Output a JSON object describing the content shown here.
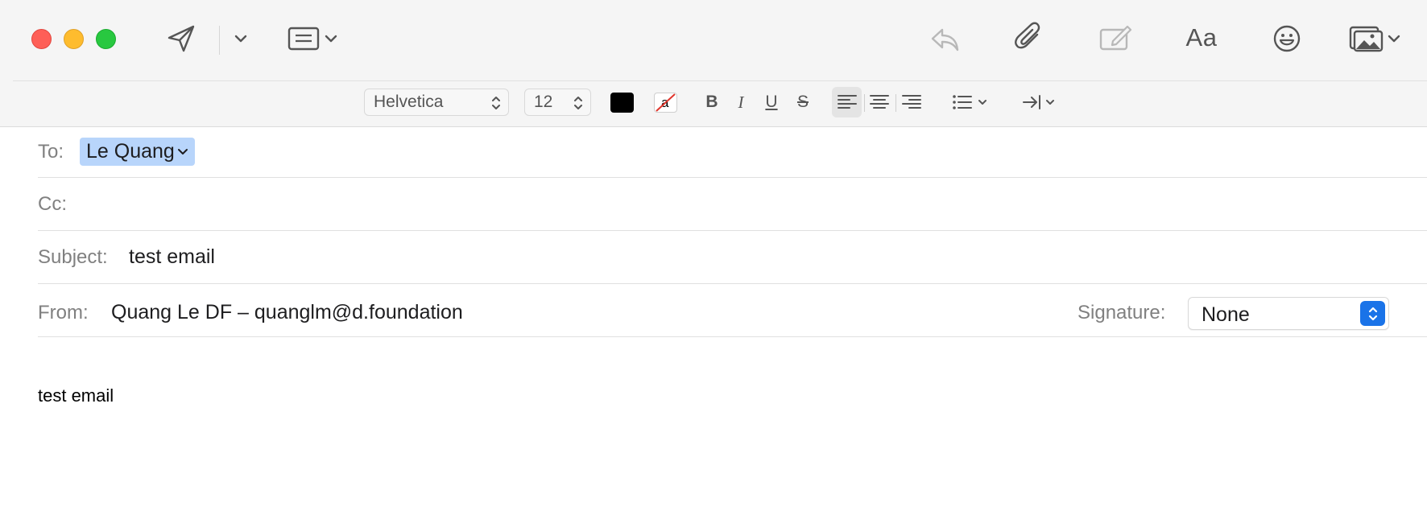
{
  "toolbar": {
    "icons": {
      "send": "paper-plane-icon",
      "send_menu": "chevron-down-icon",
      "header_fields": "header-fields-icon",
      "reply": "reply-icon",
      "attach": "paperclip-icon",
      "markup": "markup-icon",
      "fonts_label": "Aa",
      "emoji": "emoji-icon",
      "photo": "photo-browser-icon"
    }
  },
  "format_bar": {
    "font_family": "Helvetica",
    "font_size": "12",
    "text_color": "#000000",
    "bold_label": "B",
    "italic_label": "I",
    "underline_label": "U",
    "strike_label": "S",
    "alignment_active": "left"
  },
  "header": {
    "to_label": "To:",
    "to_recipient": "Le Quang",
    "cc_label": "Cc:",
    "cc_value": "",
    "subject_label": "Subject:",
    "subject_value": "test email",
    "from_label": "From:",
    "from_value": "Quang Le DF – quanglm@d.foundation",
    "signature_label": "Signature:",
    "signature_value": "None"
  },
  "message": {
    "body": "test email"
  },
  "colors": {
    "accent": "#1a73e8",
    "token_bg": "#b8d5fb",
    "close": "#fe5f57",
    "minimize": "#febc2e",
    "maximize": "#28c840"
  }
}
